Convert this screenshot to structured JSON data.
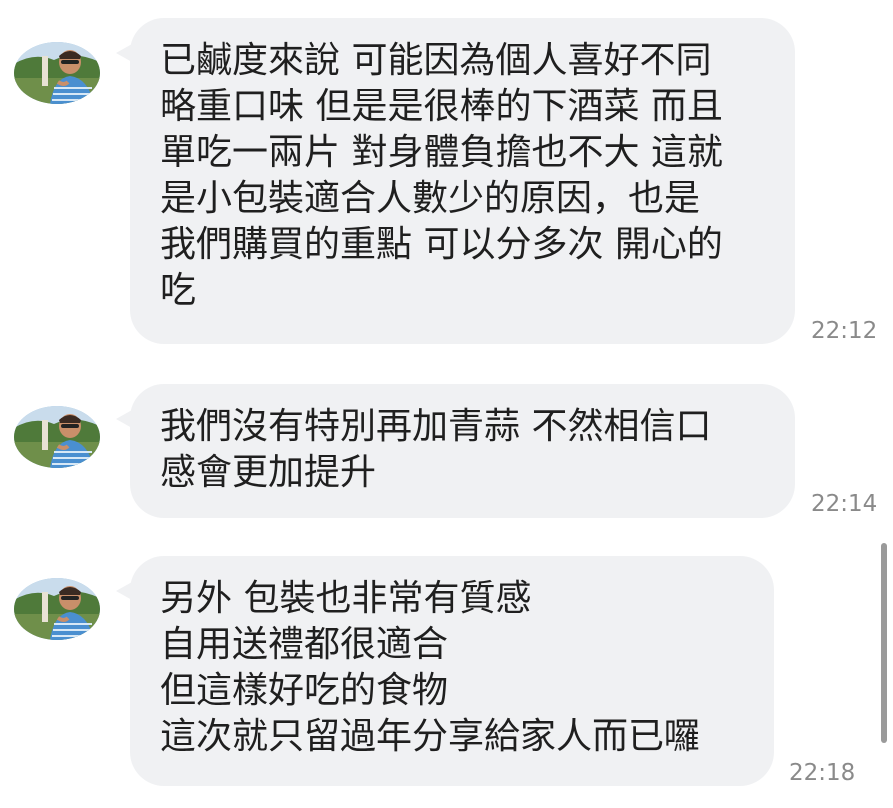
{
  "messages": [
    {
      "lines": [
        "已鹹度來說 可能因為個人喜好不同",
        "略重口味 但是是很棒的下酒菜 而且",
        "單吃一兩片 對身體負擔也不大 這就",
        "是小包裝適合人數少的原因，也是",
        "我們購買的重點 可以分多次 開心的",
        "吃"
      ],
      "time": "22:12"
    },
    {
      "lines": [
        "我們沒有特別再加青蒜 不然相信口",
        "感會更加提升"
      ],
      "time": "22:14"
    },
    {
      "lines": [
        "另外 包裝也非常有質感",
        "自用送禮都很適合",
        "但這樣好吃的食物",
        "這次就只留過年分享給家人而已囉"
      ],
      "time": "22:18"
    }
  ],
  "colors": {
    "bubble": "#f0f1f3",
    "text": "#1f1f1f",
    "timestamp": "#8a8a8a",
    "scrollbar": "#9a9a9a"
  },
  "icons": {
    "avatar": "user-avatar-photo"
  }
}
